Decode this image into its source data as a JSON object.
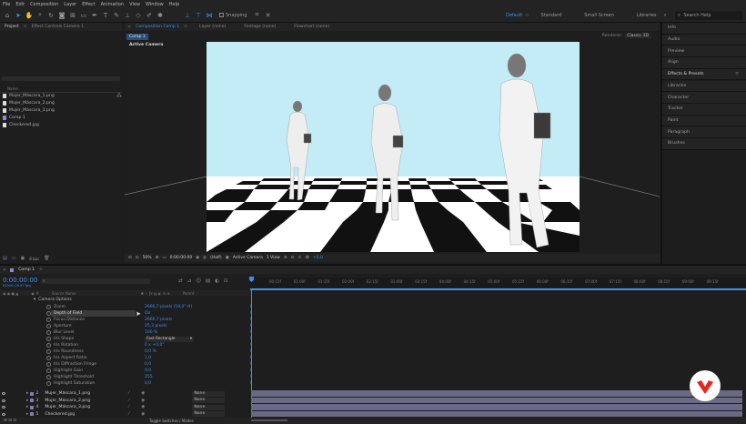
{
  "menu": [
    "File",
    "Edit",
    "Composition",
    "Layer",
    "Effect",
    "Animation",
    "View",
    "Window",
    "Help"
  ],
  "toolbar": {
    "snapping": "Snapping",
    "workspaces": [
      "Default",
      "Standard",
      "Small Screen",
      "Libraries"
    ],
    "active_workspace": "Default",
    "search_placeholder": "Search Help"
  },
  "project_panel": {
    "tabs": [
      "Project",
      "Effect Controls Camera 1"
    ],
    "name_col": "Name",
    "items": [
      {
        "name": "Mujer_Máscara_1.png",
        "type": "png"
      },
      {
        "name": "Mujer_Máscara_2.png",
        "type": "png"
      },
      {
        "name": "Mujer_Máscara_3.png",
        "type": "png"
      },
      {
        "name": "Comp 1",
        "type": "comp"
      },
      {
        "name": "Checkered.jpg",
        "type": "png"
      }
    ],
    "bpc": "8 bpc"
  },
  "comp_panel": {
    "tabs": [
      "Composition Comp 1",
      "Layer (none)",
      "Footage (none)",
      "Flowchart (none)"
    ],
    "sub_tab": "Comp 1",
    "renderer_label": "Renderer:",
    "renderer": "Classic 3D",
    "view_label": "Active Camera",
    "zoom": "50%",
    "time": "0:00:00:00",
    "resolution": "(Half)",
    "camera": "Active Camera",
    "views": "1 View",
    "exposure": "+0,0"
  },
  "right_panels": [
    "Info",
    "Audio",
    "Preview",
    "Align",
    "Effects & Presets",
    "Libraries",
    "Character",
    "Tracker",
    "Paint",
    "Paragraph",
    "Brushes"
  ],
  "timeline": {
    "tab": "Comp 1",
    "timecode": "0:00:00:00",
    "timecode_sub": "00000 (29.97 fps)",
    "source_name_col": "Source Name",
    "parent_col": "Parent",
    "ticks": [
      "00:15f",
      "01:00f",
      "01:15f",
      "02:00f",
      "02:15f",
      "03:00f",
      "03:15f",
      "04:00f",
      "04:15f",
      "05:00f",
      "05:15f",
      "06:00f",
      "06:15f",
      "07:00f",
      "07:15f",
      "08:00f",
      "08:15f",
      "09:00f",
      "09:15f"
    ],
    "camera_options": "Camera Options",
    "properties": [
      {
        "name": "Zoom",
        "value": "2666,7 pixels (19,0° H)"
      },
      {
        "name": "Depth of Field",
        "value": "On"
      },
      {
        "name": "Focus Distance",
        "value": "2666,7 pixels"
      },
      {
        "name": "Aperture",
        "value": "25,3 pixels"
      },
      {
        "name": "Blur Level",
        "value": "100 %"
      },
      {
        "name": "Iris Shape",
        "value": "Fast Rectangle"
      },
      {
        "name": "Iris Rotation",
        "value": "0 x +0,0°"
      },
      {
        "name": "Iris Roundness",
        "value": "0,0 %"
      },
      {
        "name": "Iris Aspect Ratio",
        "value": "1,0"
      },
      {
        "name": "Iris Diffraction Fringe",
        "value": "0,0"
      },
      {
        "name": "Highlight Gain",
        "value": "0,0"
      },
      {
        "name": "Highlight Threshold",
        "value": "255"
      },
      {
        "name": "Highlight Saturation",
        "value": "0,0"
      }
    ],
    "layers": [
      {
        "num": "2",
        "name": "Mujer_Máscara_1.png",
        "parent": "None"
      },
      {
        "num": "3",
        "name": "Mujer_Máscara_2.png",
        "parent": "None"
      },
      {
        "num": "4",
        "name": "Mujer_Máscara_3.png",
        "parent": "None"
      },
      {
        "num": "5",
        "name": "Checkered.jpg",
        "parent": "None"
      }
    ],
    "footer": "Toggle Switches / Modes"
  },
  "colors": {
    "accent": "#3d8ff5",
    "sky": "#c3ecf6",
    "layer_bar": "#6a6a86",
    "logo_red": "#e8251f"
  }
}
